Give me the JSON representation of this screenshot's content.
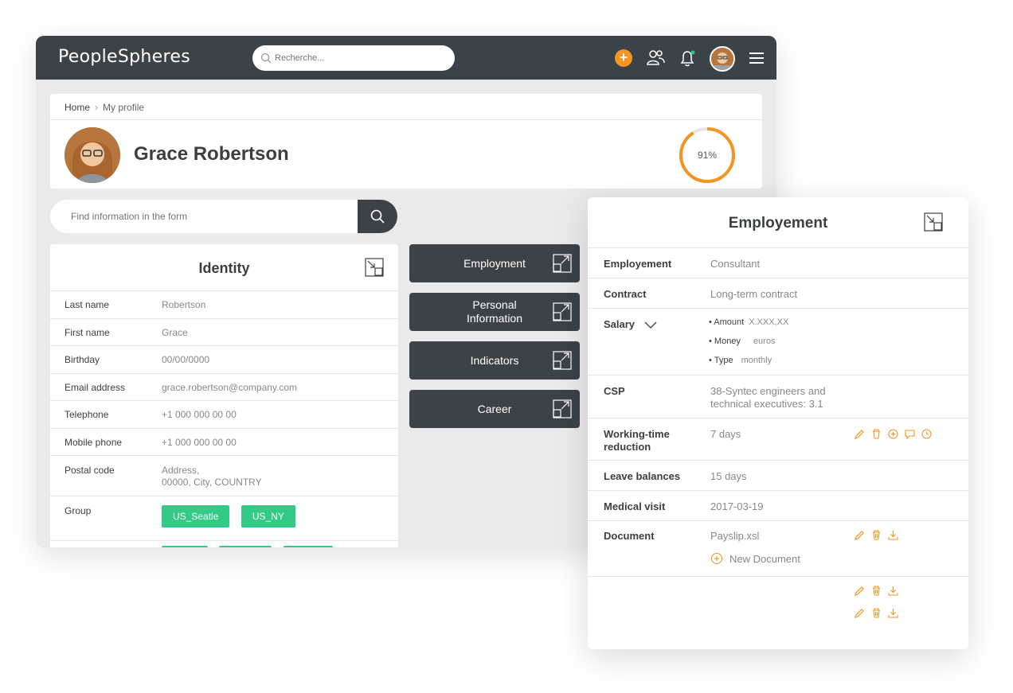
{
  "app": {
    "logo": "PeopleSpheres",
    "search_placeholder": "Recherche..."
  },
  "header": {
    "breadcrumb_home": "Home",
    "breadcrumb_current": "My profile",
    "name": "Grace Robertson",
    "completion_label": "91%",
    "completion": 0.91
  },
  "form_search": {
    "placeholder": "Find information in the form"
  },
  "identity": {
    "title": "Identity",
    "rows": [
      {
        "label": "Last name",
        "value": "Robertson"
      },
      {
        "label": "First name",
        "value": "Grace"
      },
      {
        "label": "Birthday",
        "value": "00/00/0000"
      },
      {
        "label": "Email address",
        "value": "grace.robertson@company.com"
      },
      {
        "label": "Telephone",
        "value": "+1 000 000 00 00"
      },
      {
        "label": "Mobile phone",
        "value": "+1 000 000 00 00"
      },
      {
        "label": "Postal code",
        "value_line1": "Address,",
        "value_line2": "00000, City, COUNTRY"
      },
      {
        "label": "Group",
        "tags": [
          "US_Seatle",
          "US_NY"
        ]
      }
    ]
  },
  "sections": [
    {
      "label": "Employment"
    },
    {
      "label_line1": "Personal",
      "label_line2": "Information"
    },
    {
      "label": "Indicators"
    },
    {
      "label": "Career"
    }
  ],
  "employment": {
    "title": "Employement",
    "employement_label": "Employement",
    "employement_value": "Consultant",
    "contract_label": "Contract",
    "contract_value": "Long-term contract",
    "salary_label": "Salary",
    "salary_amount_label": "• Amount",
    "salary_amount_value": "X.XXX,XX",
    "salary_money_label": "• Money",
    "salary_money_value": "euros",
    "salary_type_label": "• Type",
    "salary_type_value": "monthly",
    "csp_label": "CSP",
    "csp_value_line1": "38-Syntec engineers and",
    "csp_value_line2": "technical executives: 3.1",
    "wtr_label_line1": "Working-time",
    "wtr_label_line2": "reduction",
    "wtr_value": "7 days",
    "leave_label": "Leave balances",
    "leave_value": "15 days",
    "medical_label": "Medical visit",
    "medical_value": "2017-03-19",
    "document_label": "Document",
    "document_value": "Payslip.xsl",
    "new_document_label": "New Document"
  },
  "colors": {
    "accent": "#f59420",
    "dark": "#3b4348",
    "tag_green": "#33c987"
  }
}
